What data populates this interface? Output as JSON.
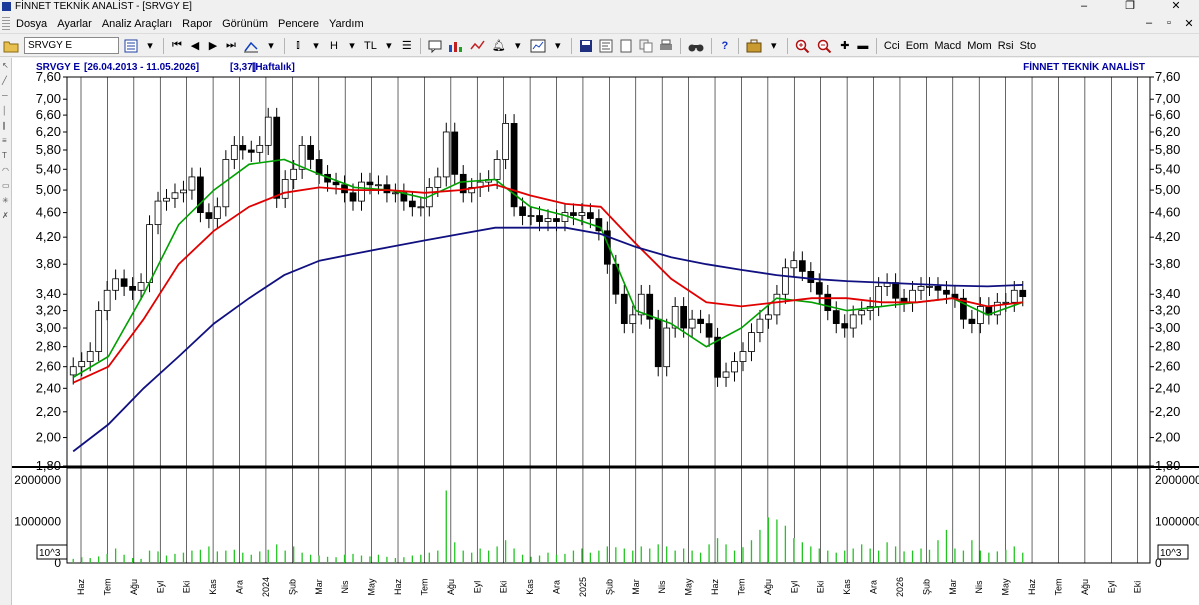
{
  "window": {
    "title": "FİNNET TEKNİK ANALİST - [SRVGY E]",
    "controls": [
      "–",
      "❐",
      "✕"
    ],
    "mdi_controls": [
      "–",
      "▫",
      "✕"
    ]
  },
  "menu": [
    "Dosya",
    "Ayarlar",
    "Analiz Araçları",
    "Rapor",
    "Görünüm",
    "Pencere",
    "Yardım"
  ],
  "toolbar": {
    "symbol_value": "SRVGY E",
    "currency": "TL",
    "heikin": "H",
    "indicators": [
      "Cci",
      "Eom",
      "Macd",
      "Mom",
      "Rsi",
      "Sto"
    ]
  },
  "chart_header": {
    "symbol": "SRVGY E",
    "range": "[26.04.2013 - 11.05.2026]",
    "last": "[3,37]",
    "period": "[Haftalık]",
    "brand": "FİNNET TEKNİK ANALİST"
  },
  "colors": {
    "candle": "#000000",
    "ma_short": "#00a000",
    "ma_mid": "#e00000",
    "ma_long": "#101080",
    "volume": "#22c422",
    "header_text": "#0000a0"
  },
  "chart_data": {
    "type": "line",
    "price_axis": {
      "scale": "log",
      "ticks": [
        "7,60",
        "7,00",
        "6,60",
        "6,20",
        "5,80",
        "5,40",
        "5,00",
        "4,60",
        "4,20",
        "3,80",
        "3,40",
        "3,20",
        "3,00",
        "2,80",
        "2,60",
        "2,40",
        "2,20",
        "2,00",
        "1,80"
      ],
      "range": [
        1.8,
        7.6
      ]
    },
    "volume_axis": {
      "ticks": [
        "2000000",
        "1000000",
        "0"
      ],
      "unit_label": "10^3"
    },
    "x_ticks": [
      "Haz",
      "Tem",
      "Ağu",
      "Eyl",
      "Eki",
      "Kas",
      "Ara",
      "2024",
      "Şub",
      "Mar",
      "Nis",
      "May",
      "Haz",
      "Tem",
      "Ağu",
      "Eyl",
      "Eki",
      "Kas",
      "Ara",
      "2025",
      "Şub",
      "Mar",
      "Nis",
      "May",
      "Haz",
      "Tem",
      "Ağu",
      "Eyl",
      "Eki",
      "Kas",
      "Ara",
      "2026",
      "Şub",
      "Mar",
      "Nis",
      "May",
      "Haz",
      "Tem",
      "Ağu",
      "Eyl",
      "Eki"
    ],
    "close": [
      2.6,
      2.65,
      2.75,
      3.2,
      3.45,
      3.6,
      3.5,
      3.45,
      3.55,
      4.4,
      4.8,
      4.85,
      4.95,
      5.0,
      5.25,
      4.6,
      4.5,
      4.7,
      5.6,
      5.9,
      5.8,
      5.75,
      5.9,
      6.55,
      4.85,
      5.2,
      5.4,
      5.9,
      5.6,
      5.3,
      5.15,
      5.1,
      4.95,
      4.8,
      5.15,
      5.1,
      5.1,
      4.95,
      4.95,
      4.8,
      4.7,
      4.7,
      5.05,
      5.25,
      6.2,
      5.3,
      4.95,
      5.05,
      5.15,
      5.2,
      5.6,
      6.4,
      4.7,
      4.55,
      4.55,
      4.45,
      4.5,
      4.45,
      4.6,
      4.55,
      4.6,
      4.5,
      4.3,
      3.8,
      3.4,
      3.05,
      3.15,
      3.4,
      3.1,
      2.6,
      3.0,
      3.25,
      3.0,
      3.1,
      3.05,
      2.9,
      2.5,
      2.55,
      2.65,
      2.75,
      2.95,
      3.1,
      3.15,
      3.4,
      3.75,
      3.85,
      3.7,
      3.55,
      3.4,
      3.2,
      3.05,
      3.0,
      3.15,
      3.2,
      3.25,
      3.5,
      3.55,
      3.35,
      3.3,
      3.45,
      3.5,
      3.5,
      3.45,
      3.4,
      3.35,
      3.1,
      3.05,
      3.25,
      3.15,
      3.3,
      3.3,
      3.45,
      3.37
    ],
    "volume": [
      0.1,
      0.14,
      0.12,
      0.16,
      0.22,
      0.35,
      0.2,
      0.12,
      0.1,
      0.3,
      0.28,
      0.18,
      0.22,
      0.25,
      0.3,
      0.32,
      0.4,
      0.28,
      0.3,
      0.32,
      0.25,
      0.2,
      0.28,
      0.32,
      0.45,
      0.3,
      0.4,
      0.25,
      0.2,
      0.18,
      0.15,
      0.14,
      0.2,
      0.22,
      0.18,
      0.16,
      0.2,
      0.15,
      0.12,
      0.14,
      0.18,
      0.2,
      0.25,
      0.3,
      1.75,
      0.5,
      0.3,
      0.25,
      0.35,
      0.3,
      0.4,
      0.55,
      0.35,
      0.2,
      0.15,
      0.18,
      0.25,
      0.2,
      0.22,
      0.3,
      0.35,
      0.25,
      0.3,
      0.4,
      0.38,
      0.35,
      0.3,
      0.4,
      0.35,
      0.45,
      0.4,
      0.3,
      0.35,
      0.3,
      0.25,
      0.45,
      0.6,
      0.45,
      0.3,
      0.38,
      0.55,
      0.8,
      1.1,
      1.05,
      0.9,
      0.6,
      0.5,
      0.4,
      0.35,
      0.3,
      0.25,
      0.3,
      0.35,
      0.45,
      0.35,
      0.3,
      0.5,
      0.4,
      0.28,
      0.3,
      0.35,
      0.32,
      0.55,
      0.8,
      0.35,
      0.3,
      0.55,
      0.3,
      0.25,
      0.28,
      0.32,
      0.4,
      0.25
    ],
    "series": [
      {
        "values": [
          2.5,
          2.7,
          3.4,
          4.4,
          5.0,
          5.5,
          5.6,
          5.3,
          5.05,
          5.0,
          4.85,
          5.15,
          5.2,
          4.7,
          4.55,
          4.35,
          3.2,
          3.05,
          2.8,
          3.0,
          3.35,
          3.3,
          3.2,
          3.25,
          3.3,
          3.35,
          3.15,
          3.3
        ]
      },
      {
        "values": [
          2.45,
          2.6,
          3.1,
          3.8,
          4.3,
          4.7,
          4.95,
          5.05,
          5.0,
          5.0,
          4.95,
          5.0,
          5.1,
          4.9,
          4.75,
          4.7,
          4.1,
          3.6,
          3.3,
          3.25,
          3.3,
          3.35,
          3.35,
          3.3,
          3.3,
          3.35,
          3.25,
          3.3
        ]
      },
      {
        "values": [
          1.9,
          2.1,
          2.4,
          2.7,
          3.05,
          3.35,
          3.65,
          3.85,
          3.95,
          4.05,
          4.15,
          4.25,
          4.35,
          4.35,
          4.35,
          4.25,
          4.05,
          3.9,
          3.8,
          3.72,
          3.65,
          3.6,
          3.57,
          3.55,
          3.53,
          3.51,
          3.5,
          3.52
        ]
      }
    ]
  }
}
